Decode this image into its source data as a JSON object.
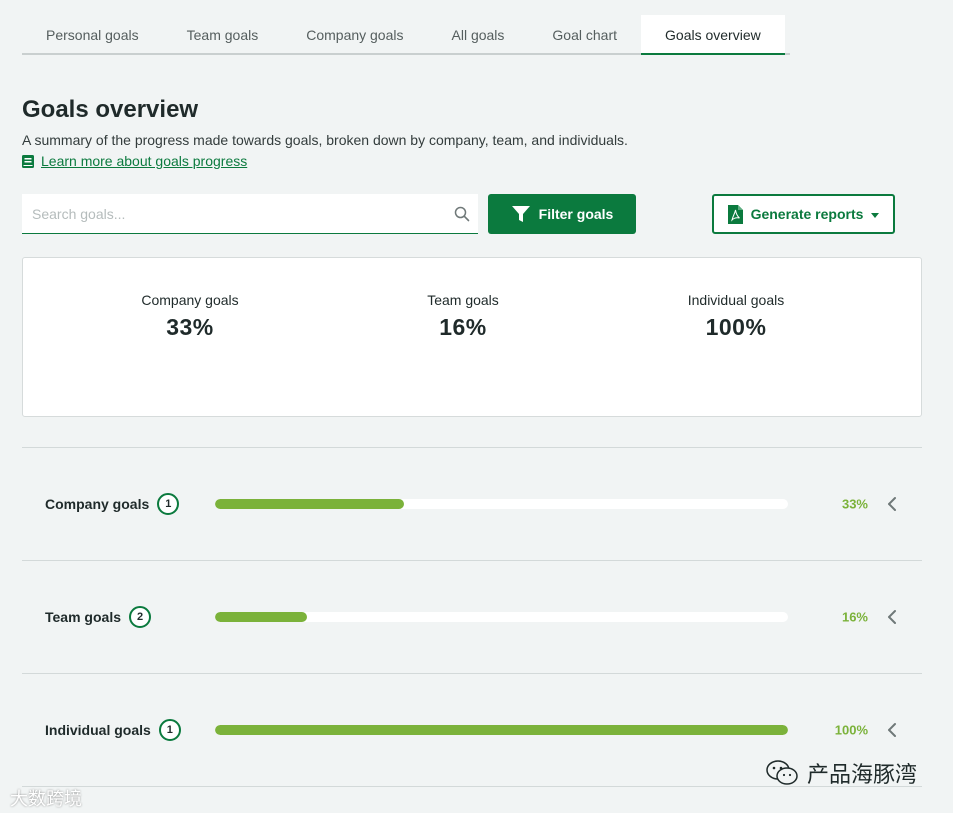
{
  "tabs": [
    {
      "label": "Personal goals",
      "active": false
    },
    {
      "label": "Team goals",
      "active": false
    },
    {
      "label": "Company goals",
      "active": false
    },
    {
      "label": "All goals",
      "active": false
    },
    {
      "label": "Goal chart",
      "active": false
    },
    {
      "label": "Goals overview",
      "active": true
    }
  ],
  "header": {
    "title": "Goals overview",
    "description": "A summary of the progress made towards goals, broken down by company, team, and individuals.",
    "learn_link": "Learn more about goals progress"
  },
  "toolbar": {
    "search_placeholder": "Search goals...",
    "filter_label": "Filter goals",
    "report_label": "Generate reports"
  },
  "summary": [
    {
      "label": "Company goals",
      "value": "33%"
    },
    {
      "label": "Team goals",
      "value": "16%"
    },
    {
      "label": "Individual goals",
      "value": "100%"
    }
  ],
  "rows": [
    {
      "label": "Company goals",
      "count": "1",
      "percent_text": "33%",
      "progress": 0.33
    },
    {
      "label": "Team goals",
      "count": "2",
      "percent_text": "16%",
      "progress": 0.16
    },
    {
      "label": "Individual goals",
      "count": "1",
      "percent_text": "100%",
      "progress": 1.0
    }
  ],
  "watermarks": {
    "left": "大数跨境",
    "right": "产品海豚湾"
  },
  "colors": {
    "brand_green": "#0b7a3e",
    "progress_green": "#7bb23a",
    "background": "#f1f4f4"
  }
}
